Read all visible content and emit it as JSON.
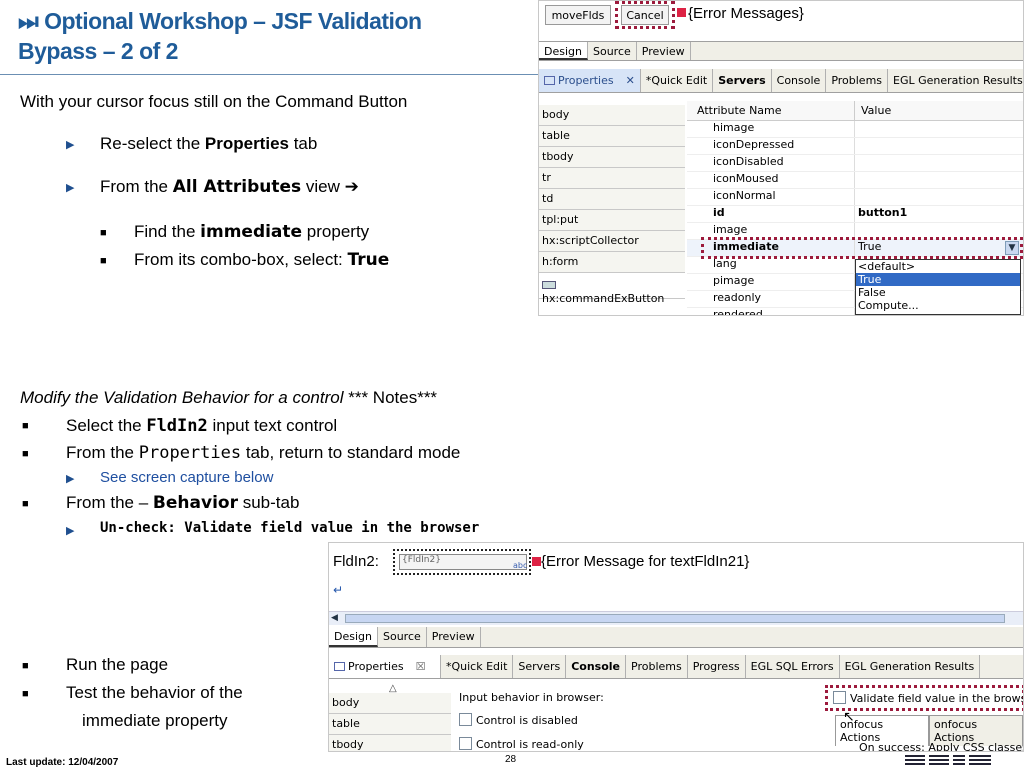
{
  "title": {
    "line1": "⏭ Optional Workshop – JSF Validation",
    "line2": "Bypass – 2 of 2"
  },
  "intro": "With your cursor focus still on the Command Button",
  "steps": {
    "reselect_pre": "Re-select the ",
    "reselect_bold": "Properties",
    "reselect_post": " tab",
    "from_pre": "From the ",
    "from_bold": "All Attributes",
    "from_post": " view ➔",
    "find_pre": "Find the ",
    "find_bold": "immediate",
    "find_post": " property",
    "combo_pre": "From its combo-box, select: ",
    "combo_bold": "True"
  },
  "modify": {
    "heading_italic": "Modify the Validation Behavior for a control",
    "heading_rest": " *** Notes***",
    "select_pre": "Select the ",
    "select_bold": "FldIn2",
    "select_post": " input text control",
    "props_pre": "From the ",
    "props_mono": "Properties",
    "props_post": " tab, return to standard mode",
    "see_capture": "See screen capture below",
    "behavior_pre": "From the  – ",
    "behavior_bold": "Behavior",
    "behavior_post": " sub-tab",
    "uncheck": "Un-check: Validate field value in the browser"
  },
  "run": {
    "run_page": "Run the page",
    "test_line1": "Test the behavior of the",
    "test_line2": "immediate property"
  },
  "footer": {
    "last_update": "Last update: 12/04/2007",
    "page_number": "28"
  },
  "shot1": {
    "buttons": {
      "move": "moveFlds",
      "cancel": "Cancel",
      "errors": "{Error Messages}"
    },
    "editor_tabs": [
      "Design",
      "Source",
      "Preview"
    ],
    "view_tabs": [
      "Properties",
      "*Quick Edit",
      "Servers",
      "Console",
      "Problems",
      "EGL Generation Results"
    ],
    "left_items": [
      "body",
      "table",
      "tbody",
      "tr",
      "td",
      "tpl:put",
      "hx:scriptCollector",
      "h:form",
      "hx:commandExButton"
    ],
    "grid_headers": [
      "Attribute Name",
      "Value"
    ],
    "attributes": [
      {
        "name": "himage",
        "value": ""
      },
      {
        "name": "iconDepressed",
        "value": ""
      },
      {
        "name": "iconDisabled",
        "value": ""
      },
      {
        "name": "iconMoused",
        "value": ""
      },
      {
        "name": "iconNormal",
        "value": ""
      },
      {
        "name": "id",
        "value": "button1"
      },
      {
        "name": "image",
        "value": ""
      },
      {
        "name": "immediate",
        "value": "True"
      },
      {
        "name": "lang",
        "value": ""
      },
      {
        "name": "pimage",
        "value": ""
      },
      {
        "name": "readonly",
        "value": ""
      },
      {
        "name": "rendered",
        "value": ""
      }
    ],
    "combo_options": [
      "<default>",
      "True",
      "False",
      "Compute..."
    ]
  },
  "shot2": {
    "label": "FldIn2:",
    "field_value": "{FldIn2}",
    "error_msg": "{Error Message for textFldIn21}",
    "editor_tabs": [
      "Design",
      "Source",
      "Preview"
    ],
    "view_tabs": [
      "Properties",
      "*Quick Edit",
      "Servers",
      "Console",
      "Problems",
      "Progress",
      "EGL SQL Errors",
      "EGL Generation Results"
    ],
    "left_items": [
      "body",
      "table",
      "tbody"
    ],
    "input_behavior": "Input behavior in browser:",
    "control_disabled": "Control is disabled",
    "control_readonly": "Control is read-only",
    "validate": "Validate field value in the browser",
    "sub_tabs": [
      "onfocus Actions",
      "onfocus Actions"
    ],
    "on_success": "On success:  Apply CSS classes:"
  }
}
